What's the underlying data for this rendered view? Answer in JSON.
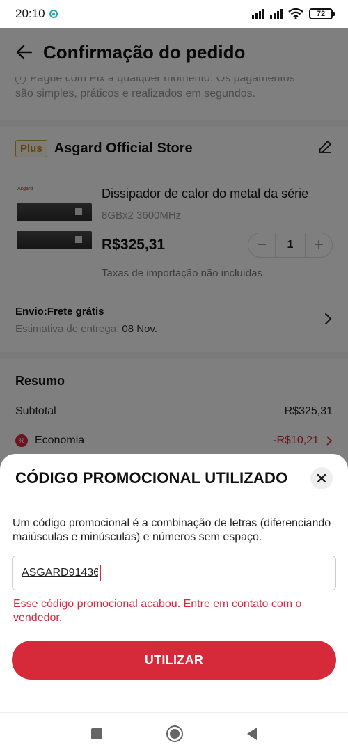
{
  "status_bar": {
    "time": "20:10",
    "battery": "72"
  },
  "header": {
    "title": "Confirmação do pedido"
  },
  "pix_note": {
    "line1": "Pague com Pix a qualquer momento. Os pagamentos",
    "line2": "são simples, práticos e realizados em segundos."
  },
  "store": {
    "badge": "Plus",
    "name": "Asgard Official Store"
  },
  "product": {
    "logo_text": "Asgard",
    "title": "Dissipador de calor do metal da série",
    "variant": "8GBx2 3600MHz",
    "price": "R$325,31",
    "quantity": "1",
    "minus": "−",
    "plus": "+",
    "tax_note": "Taxas de importação não incluídas"
  },
  "shipping": {
    "title": "Envio:Frete grátis",
    "estimate_label": "Estimativa de entrega:",
    "estimate_date": "08 Nov."
  },
  "summary": {
    "title": "Resumo",
    "subtotal_label": "Subtotal",
    "subtotal_value": "R$325,31",
    "economy_label": "Economia",
    "economy_value": "-R$10,21"
  },
  "promo_sheet": {
    "title": "CÓDIGO PROMOCIONAL UTILIZADO",
    "description": "Um código promocional é a combinação de letras (diferenciando maiúsculas e minúsculas) e números sem espaço.",
    "input_value": "ASGARD91436",
    "error": "Esse código promocional acabou. Entre em contato com o vendedor.",
    "button_label": "UTILIZAR"
  },
  "colors": {
    "accent": "#d6293a",
    "overlay": "rgba(0,0,0,0.5)"
  }
}
